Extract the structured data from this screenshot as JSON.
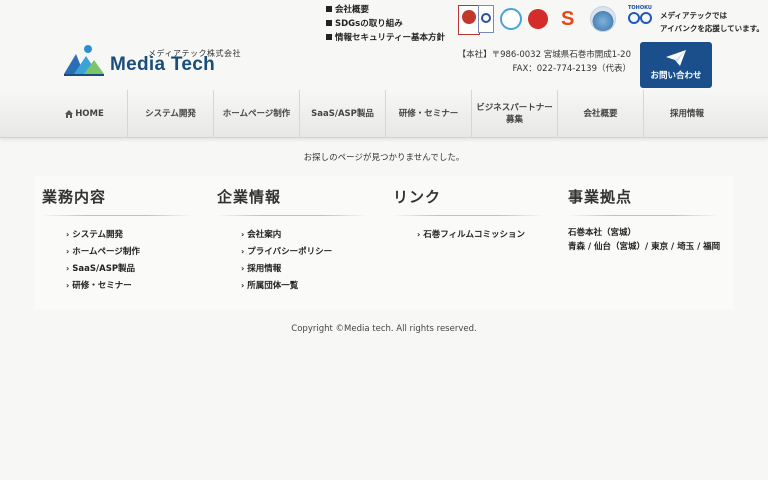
{
  "header": {
    "logo": {
      "sub": "メディアテック株式会社",
      "main": "Media Tech"
    },
    "top_links": [
      {
        "label": "会社概要"
      },
      {
        "label": "SDGsの取り組み"
      },
      {
        "label": "情報セキュリティー基本方針"
      }
    ],
    "badge_text": {
      "tohoku": "TOHOKU"
    },
    "support_text": [
      "メディアテックでは",
      "アイバンクを応援しています。"
    ],
    "address": {
      "line1": "【本社】〒986-0032 宮城県石巻市開成1-20",
      "line2": "FAX：022-774-2139（代表）"
    },
    "contact_button": {
      "label": "お問い合わせ",
      "icon": "paper-plane-icon"
    },
    "colors": {
      "brand": "#1a4f8b",
      "accent": "#a7c6e2"
    }
  },
  "nav": {
    "items": [
      {
        "label": "HOME",
        "icon": "home-icon"
      },
      {
        "label": "システム開発"
      },
      {
        "label": "ホームページ制作"
      },
      {
        "label": "SaaS/ASP製品"
      },
      {
        "label": "研修・セミナー"
      },
      {
        "label": "ビジネスパートナー\n募集"
      },
      {
        "label": "会社概要"
      },
      {
        "label": "採用情報"
      }
    ]
  },
  "main": {
    "not_found_message": "お探しのページが見つかりませんでした。"
  },
  "footer": {
    "columns": [
      {
        "title": "業務内容",
        "links": [
          "システム開発",
          "ホームページ制作",
          "SaaS/ASP製品",
          "研修・セミナー"
        ]
      },
      {
        "title": "企業情報",
        "links": [
          "会社案内",
          "プライバシーポリシー",
          "採用情報",
          "所属団体一覧"
        ]
      },
      {
        "title": "リンク",
        "links": [
          "石巻フィルムコミッション"
        ]
      },
      {
        "title": "事業拠点",
        "text": [
          "石巻本社（宮城）",
          "青森 / 仙台（宮城）/ 東京 / 埼玉 / 福岡"
        ]
      }
    ],
    "copyright": "Copyright ©Media tech. All rights reserved."
  }
}
